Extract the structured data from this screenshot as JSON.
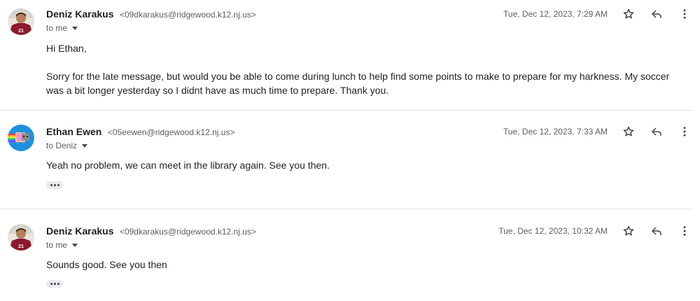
{
  "messages": [
    {
      "sender_name": "Deniz Karakus",
      "sender_email": "<09dkarakus@ridgewood.k12.nj.us>",
      "to_label": "to me",
      "date": "Tue, Dec 12, 2023, 7:29 AM",
      "body": [
        "Hi Ethan,",
        "Sorry for the late message, but would you be able to come during lunch to help find some points to make to prepare for my harkness.  My soccer was a bit longer yesterday so I didnt have as much time to prepare.  Thank you."
      ],
      "avatar": "soccer-player-photo"
    },
    {
      "sender_name": "Ethan Ewen",
      "sender_email": "<05eewen@ridgewood.k12.nj.us>",
      "to_label": "to Deniz",
      "date": "Tue, Dec 12, 2023, 7:33 AM",
      "body": [
        "Yeah no problem, we can meet in the library again. See you then."
      ],
      "avatar": "nyan-cat-avatar"
    },
    {
      "sender_name": "Deniz Karakus",
      "sender_email": "<09dkarakus@ridgewood.k12.nj.us>",
      "to_label": "to me",
      "date": "Tue, Dec 12, 2023, 10:32 AM",
      "body": [
        "Sounds good. See you then"
      ],
      "avatar": "soccer-player-photo"
    }
  ],
  "icons": {
    "star": "star-outline-icon",
    "reply": "reply-icon",
    "more": "more-vert-icon",
    "show_trimmed": "more-horiz-icon",
    "recipient_caret": "caret-down-icon"
  },
  "colors": {
    "jersey": "#8b1a2c",
    "nyan_bg": "#1e90e0",
    "divider": "#e6e6e6",
    "secondary_text": "#5e5e5e"
  }
}
